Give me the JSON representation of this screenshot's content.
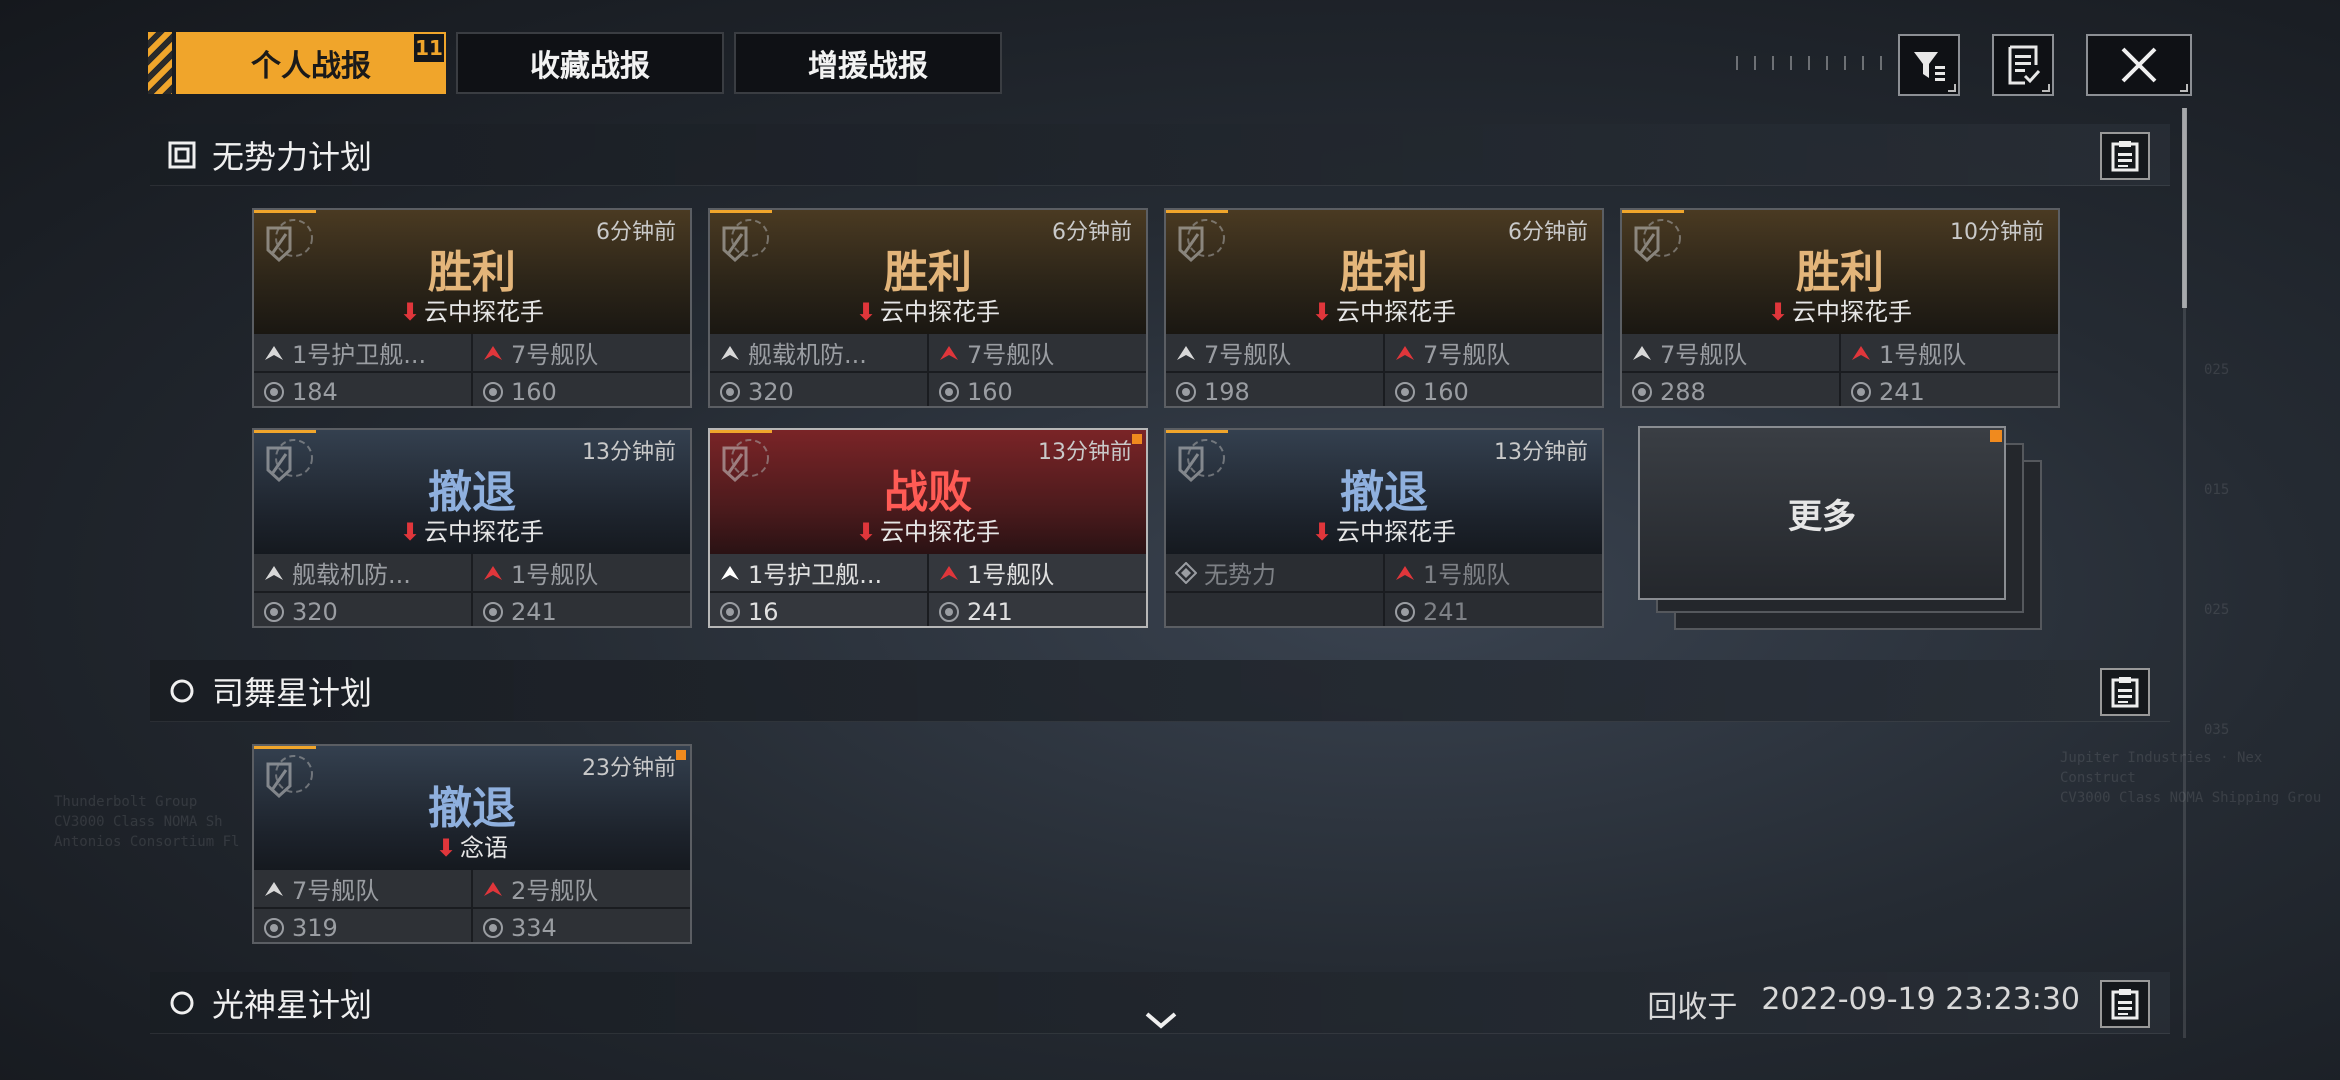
{
  "tabs": [
    {
      "label": "个人战报",
      "badge": "11",
      "active": true
    },
    {
      "label": "收藏战报",
      "active": false
    },
    {
      "label": "增援战报",
      "active": false
    }
  ],
  "toolbar": {
    "filter_icon": "filter-icon",
    "report_icon": "report-check-icon",
    "close_icon": "close-icon"
  },
  "background_text": {
    "left": [
      "Thunderbolt Group",
      "CV3000 Class NOMA Sh",
      "Antonios Consortium Fl"
    ],
    "right": [
      "Jupiter Industries · Nex Construct",
      "CV3000 Class NOMA Shipping Grou"
    ],
    "axis": [
      "025",
      "015",
      "025",
      "035"
    ]
  },
  "sections": [
    {
      "title": "无势力计划",
      "cards": [
        {
          "result": "胜利",
          "kind": "win",
          "time": "6分钟前",
          "player": "云中探花手",
          "left_unit": "1号护卫舰...",
          "right_unit": "7号舰队",
          "left_power": "184",
          "right_power": "160"
        },
        {
          "result": "胜利",
          "kind": "win",
          "time": "6分钟前",
          "player": "云中探花手",
          "left_unit": "舰载机防...",
          "right_unit": "7号舰队",
          "left_power": "320",
          "right_power": "160"
        },
        {
          "result": "胜利",
          "kind": "win",
          "time": "6分钟前",
          "player": "云中探花手",
          "left_unit": "7号舰队",
          "right_unit": "7号舰队",
          "left_power": "198",
          "right_power": "160"
        },
        {
          "result": "胜利",
          "kind": "win",
          "time": "10分钟前",
          "player": "云中探花手",
          "left_unit": "7号舰队",
          "right_unit": "1号舰队",
          "left_power": "288",
          "right_power": "241"
        },
        {
          "result": "撤退",
          "kind": "retreat",
          "time": "13分钟前",
          "player": "云中探花手",
          "left_unit": "舰载机防...",
          "right_unit": "1号舰队",
          "left_power": "320",
          "right_power": "241"
        },
        {
          "result": "战败",
          "kind": "defeat",
          "time": "13分钟前",
          "player": "云中探花手",
          "left_unit": "1号护卫舰...",
          "right_unit": "1号舰队",
          "left_power": "16",
          "right_power": "241"
        },
        {
          "result": "撤退",
          "kind": "retreat",
          "time": "13分钟前",
          "player": "云中探花手",
          "left_unit": "无势力",
          "right_unit": "1号舰队",
          "left_power": "",
          "right_power": "241"
        }
      ],
      "more_label": "更多"
    },
    {
      "title": "司舞星计划",
      "cards": [
        {
          "result": "撤退",
          "kind": "retreat",
          "time": "23分钟前",
          "player": "念语",
          "left_unit": "7号舰队",
          "right_unit": "2号舰队",
          "left_power": "319",
          "right_power": "334"
        }
      ]
    },
    {
      "title": "光神星计划",
      "recycle_label": "回收于",
      "recycle_time": "2022-09-19 23:23:30"
    }
  ]
}
